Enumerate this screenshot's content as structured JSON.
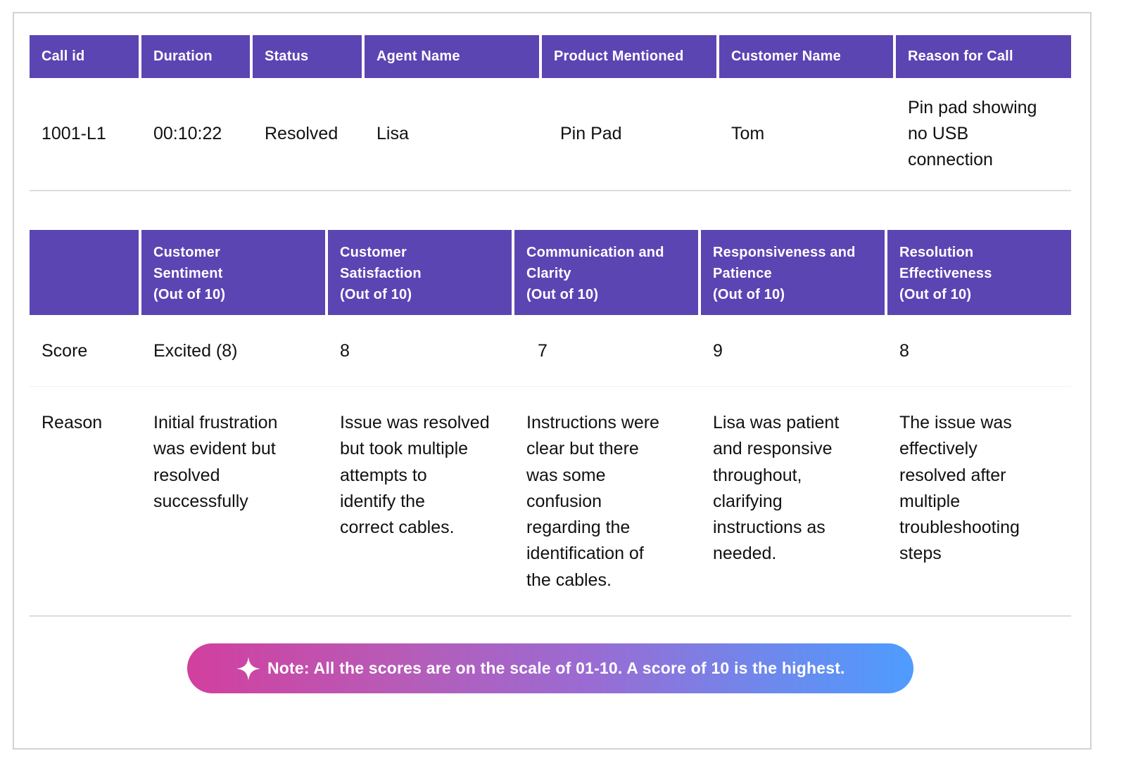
{
  "call_table": {
    "headers": [
      "Call id",
      "Duration",
      "Status",
      "Agent Name",
      "Product Mentioned",
      "Customer Name",
      "Reason for Call"
    ],
    "values": [
      "1001-L1",
      "00:10:22",
      "Resolved",
      "Lisa",
      "Pin Pad",
      "Tom",
      "Pin pad showing\nno USB\nconnection"
    ]
  },
  "score_table": {
    "headers": [
      "",
      "Customer\nSentiment\n(Out of 10)",
      "Customer\nSatisfaction\n(Out of 10)",
      "Communication and\nClarity\n(Out of 10)",
      "Responsiveness and\nPatience\n(Out of 10)",
      "Resolution\nEffectiveness\n(Out of 10)"
    ],
    "score_row": {
      "label": "Score",
      "values": [
        "Excited (8)",
        "8",
        "7",
        "9",
        "8"
      ]
    },
    "reason_row": {
      "label": "Reason",
      "values": [
        "Initial frustration\nwas evident but\nresolved\nsuccessfully",
        "Issue was resolved\nbut took multiple\nattempts to\nidentify the\ncorrect cables.",
        "Instructions were\nclear but there\nwas some\nconfusion\nregarding the\nidentification of\nthe cables.",
        "Lisa was patient\nand responsive\nthroughout,\nclarifying\ninstructions as\nneeded.",
        "The issue was\neffectively\nresolved after\nmultiple\ntroubleshooting\nsteps"
      ]
    }
  },
  "note": {
    "icon": "sparkle-icon",
    "text": "Note: All the scores are on the scale of 01-10. A score of 10 is the highest."
  },
  "colors": {
    "header_bg": "#5B45B3",
    "note_gradient_start": "#D23F9E",
    "note_gradient_end": "#4E9CFF"
  }
}
